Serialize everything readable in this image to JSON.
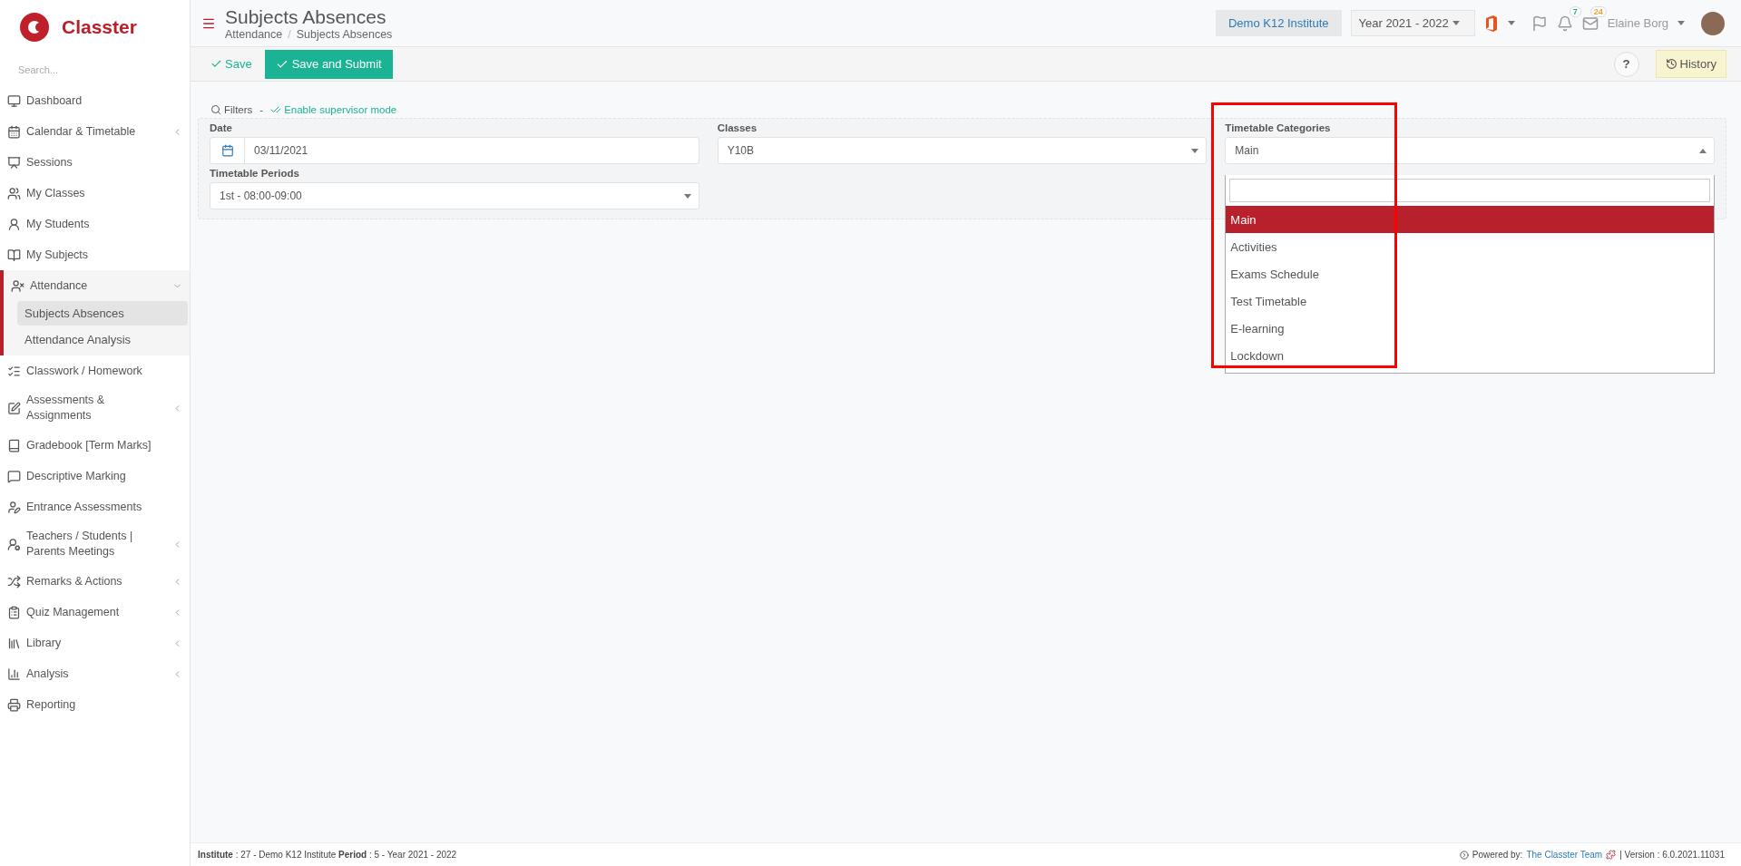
{
  "brand": {
    "name": "Classter"
  },
  "sidebar": {
    "search_placeholder": "Search...",
    "items": [
      {
        "label": "Dashboard",
        "active": false
      },
      {
        "label": "Calendar & Timetable",
        "active": false,
        "expanded": false
      },
      {
        "label": "Sessions",
        "active": false
      },
      {
        "label": "My Classes",
        "active": false
      },
      {
        "label": "My Students",
        "active": false
      },
      {
        "label": "My Subjects",
        "active": false
      },
      {
        "label": "Attendance",
        "active": true,
        "expanded": true,
        "children": [
          {
            "label": "Subjects Absences",
            "selected": true
          },
          {
            "label": "Attendance Analysis",
            "selected": false
          }
        ]
      },
      {
        "label": "Classwork / Homework",
        "active": false
      },
      {
        "label": "Assessments & Assignments",
        "active": false,
        "expanded": false
      },
      {
        "label": "Gradebook [Term Marks]",
        "active": false
      },
      {
        "label": "Descriptive Marking",
        "active": false
      },
      {
        "label": "Entrance Assessments",
        "active": false
      },
      {
        "label": "Teachers / Students | Parents Meetings",
        "active": false,
        "expanded": false
      },
      {
        "label": "Remarks & Actions",
        "active": false,
        "expanded": false
      },
      {
        "label": "Quiz Management",
        "active": false,
        "expanded": false
      },
      {
        "label": "Library",
        "active": false,
        "expanded": false
      },
      {
        "label": "Analysis",
        "active": false,
        "expanded": false
      },
      {
        "label": "Reporting",
        "active": false
      }
    ]
  },
  "header": {
    "title": "Subjects Absences",
    "breadcrumb": [
      "Attendance",
      "Subjects Absences"
    ],
    "breadcrumb_separator": "/",
    "institute": "Demo K12 Institute",
    "year": "Year 2021 - 2022",
    "notifications_count": "7",
    "messages_count": "24",
    "user": "Elaine Borg"
  },
  "toolbar": {
    "save": "Save",
    "save_submit": "Save and Submit",
    "help": "?",
    "history": "History"
  },
  "filters": {
    "title": "Filters",
    "separator": "-",
    "supervisor": "Enable supervisor mode",
    "date": {
      "label": "Date",
      "value": "03/11/2021"
    },
    "classes": {
      "label": "Classes",
      "value": "Y10B"
    },
    "periods": {
      "label": "Timetable Periods",
      "value": "1st - 08:00-09:00"
    },
    "categories": {
      "label": "Timetable Categories",
      "value": "Main",
      "expanded": true,
      "options": [
        {
          "label": "Main",
          "selected": true
        },
        {
          "label": "Activities",
          "selected": false
        },
        {
          "label": "Exams Schedule",
          "selected": false
        },
        {
          "label": "Test Timetable",
          "selected": false
        },
        {
          "label": "E-learning",
          "selected": false
        },
        {
          "label": "Lockdown",
          "selected": false
        }
      ]
    }
  },
  "footer": {
    "info": "**Institute** : 27 - Demo K12 Institute **Period** : 5 - Year 2021 - 2022",
    "powered": "Powered by:",
    "team": "The Classter Team",
    "version": "| Version : 6.0.2021.11031"
  }
}
